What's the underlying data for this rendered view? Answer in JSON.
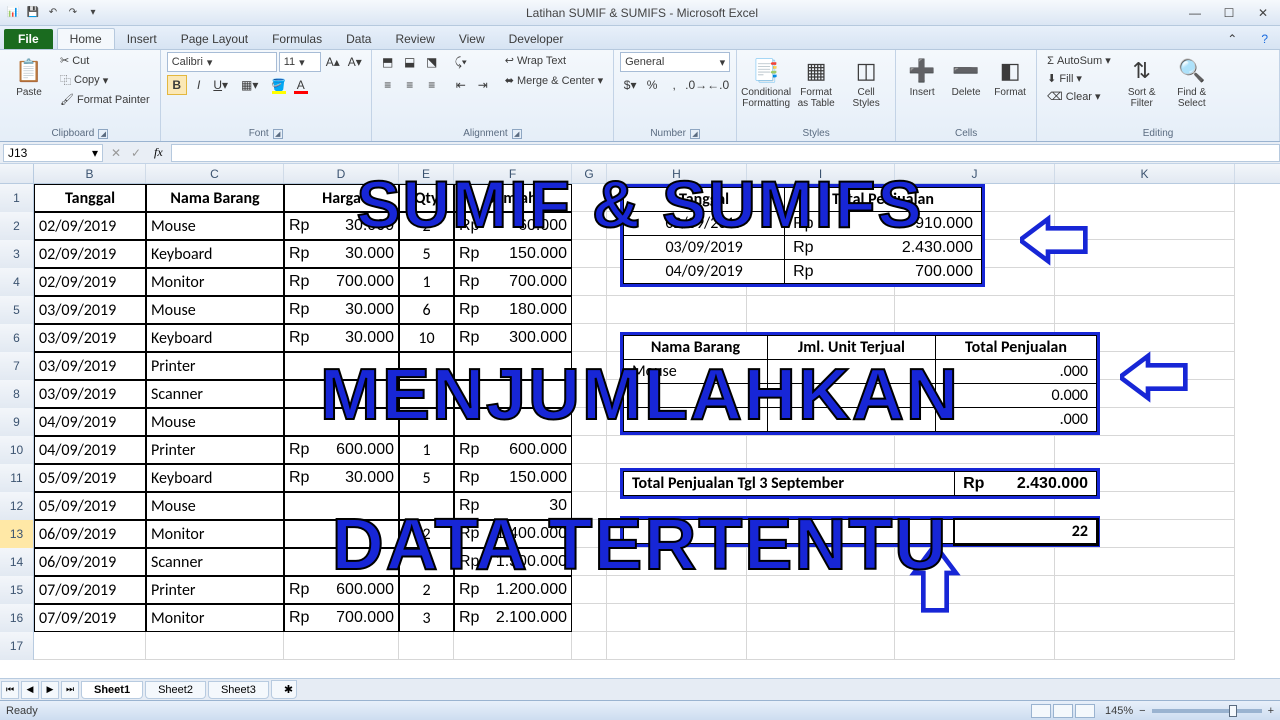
{
  "window": {
    "title": "Latihan SUMIF & SUMIFS  -  Microsoft Excel"
  },
  "qat": [
    "excel",
    "save",
    "undo",
    "redo"
  ],
  "tabs": [
    "File",
    "Home",
    "Insert",
    "Page Layout",
    "Formulas",
    "Data",
    "Review",
    "View",
    "Developer"
  ],
  "active_tab": "Home",
  "ribbon": {
    "clipboard": {
      "paste": "Paste",
      "cut": "Cut",
      "copy": "Copy",
      "fmt": "Format Painter",
      "label": "Clipboard"
    },
    "font": {
      "name": "Calibri",
      "size": "11",
      "label": "Font"
    },
    "alignment": {
      "wrap": "Wrap Text",
      "merge": "Merge & Center",
      "label": "Alignment"
    },
    "number": {
      "format": "General",
      "label": "Number"
    },
    "styles": {
      "cond": "Conditional\nFormatting",
      "table": "Format\nas Table",
      "cell": "Cell\nStyles",
      "label": "Styles"
    },
    "cells": {
      "insert": "Insert",
      "delete": "Delete",
      "format": "Format",
      "label": "Cells"
    },
    "editing": {
      "sum": "AutoSum",
      "fill": "Fill",
      "clear": "Clear",
      "sort": "Sort &\nFilter",
      "find": "Find &\nSelect",
      "label": "Editing"
    }
  },
  "namebox": "J13",
  "formula": "",
  "cols": [
    "",
    "B",
    "C",
    "D",
    "E",
    "F",
    "G",
    "H",
    "I",
    "J",
    "K"
  ],
  "headers_main": [
    "Tanggal",
    "Nama Barang",
    "Harga",
    "Qty",
    "Jumlah"
  ],
  "rows": [
    {
      "t": "02/09/2019",
      "n": "Mouse",
      "h": "30.000",
      "q": "2",
      "j": "60.000"
    },
    {
      "t": "02/09/2019",
      "n": "Keyboard",
      "h": "30.000",
      "q": "5",
      "j": "150.000"
    },
    {
      "t": "02/09/2019",
      "n": "Monitor",
      "h": "700.000",
      "q": "1",
      "j": "700.000"
    },
    {
      "t": "03/09/2019",
      "n": "Mouse",
      "h": "30.000",
      "q": "6",
      "j": "180.000"
    },
    {
      "t": "03/09/2019",
      "n": "Keyboard",
      "h": "30.000",
      "q": "10",
      "j": "300.000"
    },
    {
      "t": "03/09/2019",
      "n": "Printer",
      "h": "",
      "q": "",
      "j": ""
    },
    {
      "t": "03/09/2019",
      "n": "Scanner",
      "h": "",
      "q": "",
      "j": ""
    },
    {
      "t": "04/09/2019",
      "n": "Mouse",
      "h": "",
      "q": "",
      "j": ""
    },
    {
      "t": "04/09/2019",
      "n": "Printer",
      "h": "600.000",
      "q": "1",
      "j": "600.000"
    },
    {
      "t": "05/09/2019",
      "n": "Keyboard",
      "h": "30.000",
      "q": "5",
      "j": "150.000"
    },
    {
      "t": "05/09/2019",
      "n": "Mouse",
      "h": "",
      "q": "",
      "j": "30"
    },
    {
      "t": "06/09/2019",
      "n": "Monitor",
      "h": "",
      "q": "2",
      "j": "1.400.000"
    },
    {
      "t": "06/09/2019",
      "n": "Scanner",
      "h": "",
      "q": "",
      "j": "1.500.000"
    },
    {
      "t": "07/09/2019",
      "n": "Printer",
      "h": "600.000",
      "q": "2",
      "j": "1.200.000"
    },
    {
      "t": "07/09/2019",
      "n": "Monitor",
      "h": "700.000",
      "q": "3",
      "j": "2.100.000"
    }
  ],
  "summary1": {
    "headers": [
      "Tanggal",
      "Total Penjualan"
    ],
    "rows": [
      {
        "t": "02/09/2019",
        "v": "910.000"
      },
      {
        "t": "03/09/2019",
        "v": "2.430.000"
      },
      {
        "t": "04/09/2019",
        "v": "700.000"
      }
    ]
  },
  "summary2": {
    "headers": [
      "Nama Barang",
      "Jml. Unit Terjual",
      "Total Penjualan"
    ],
    "rows": [
      {
        "n": "Mouse",
        "u": "",
        "v": ".000"
      },
      {
        "n": "",
        "u": "",
        "v": "0.000"
      },
      {
        "n": "",
        "u": "",
        "v": ".000"
      }
    ]
  },
  "summary3": {
    "label": "Total Penjualan Tgl 3 September",
    "value": "2.430.000"
  },
  "summary4": {
    "label": "",
    "value": "22"
  },
  "overlay": {
    "l1": "SUMIF & SUMIFS",
    "l2": "MENJUMLAHKAN",
    "l3": "DATA TERTENTU"
  },
  "sheets": [
    "Sheet1",
    "Sheet2",
    "Sheet3"
  ],
  "status": {
    "ready": "Ready",
    "zoom": "145%"
  }
}
